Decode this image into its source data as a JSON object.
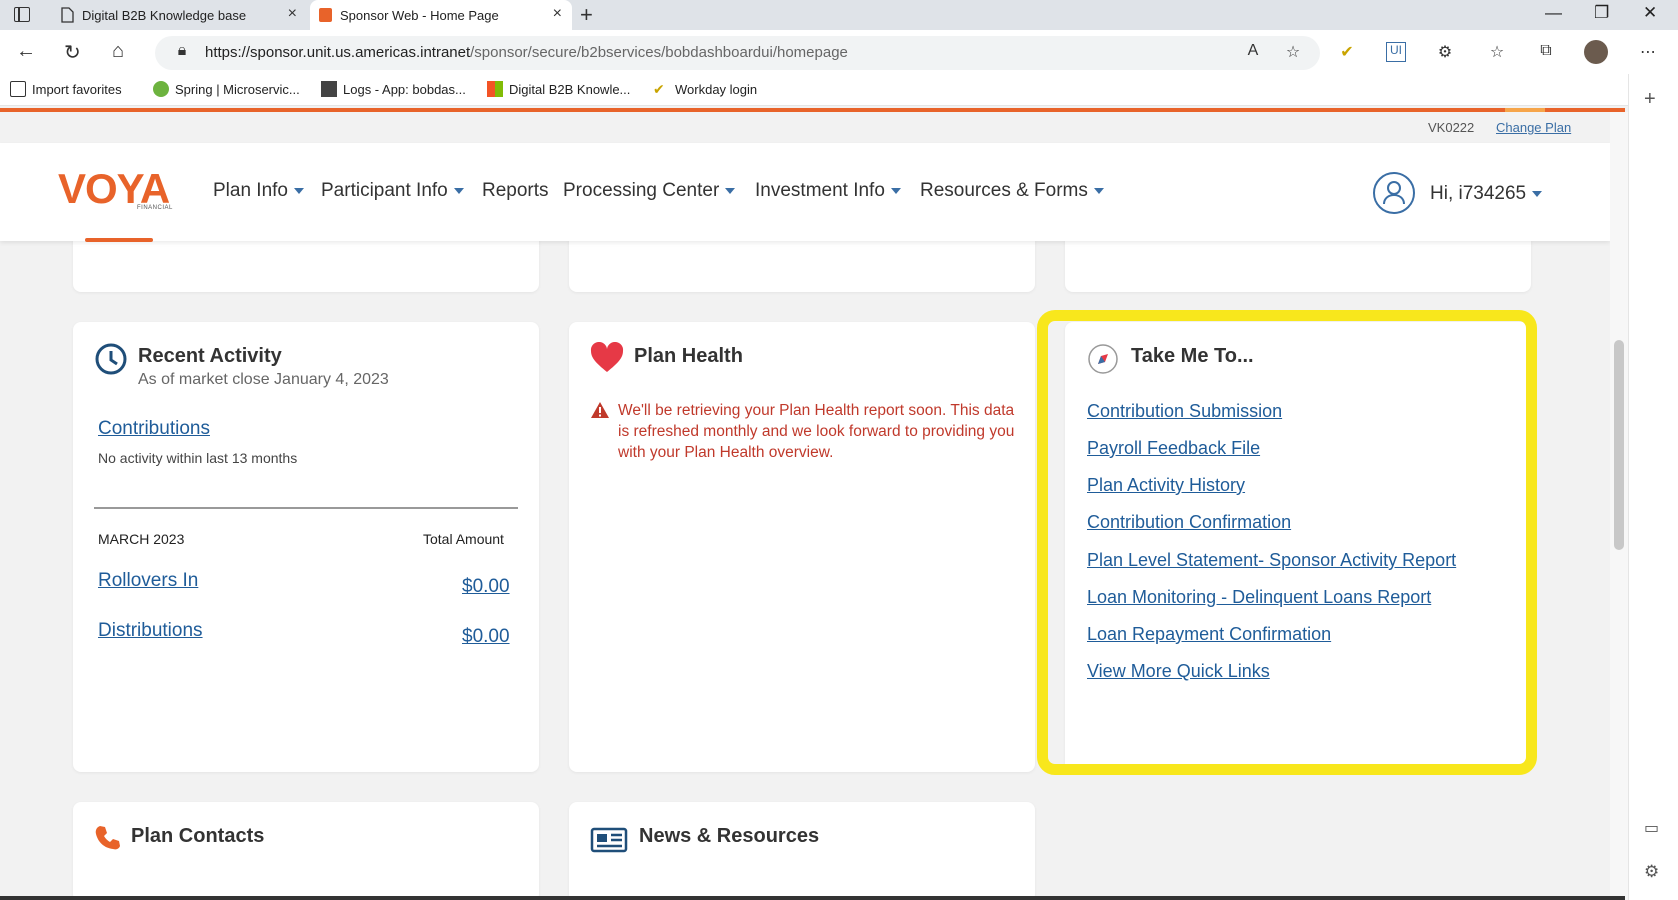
{
  "browser": {
    "tabs": [
      {
        "title": "Digital B2B Knowledge base"
      },
      {
        "title": "Sponsor Web - Home Page"
      }
    ],
    "url_host": "https://sponsor.unit.us.americas.intranet",
    "url_path": "/sponsor/secure/b2bservices/bobdashboardui/homepage",
    "favorites": [
      "Import favorites",
      "Spring | Microservic...",
      "Logs - App: bobdas...",
      "Digital B2B Knowle...",
      "Workday login"
    ]
  },
  "plan": {
    "code": "VK0222",
    "change_label": "Change Plan"
  },
  "header": {
    "logo": "VOYA",
    "logo_sub": "FINANCIAL",
    "nav": [
      "Plan Info",
      "Participant Info",
      "Reports",
      "Processing Center",
      "Investment Info",
      "Resources & Forms"
    ],
    "greeting": "Hi, i734265"
  },
  "recent_activity": {
    "title": "Recent Activity",
    "subtitle": "As of market close January 4, 2023",
    "contributions_label": "Contributions",
    "contributions_note": "No activity within last 13 months",
    "period": "MARCH 2023",
    "total_header": "Total Amount",
    "rows": [
      {
        "label": "Rollovers In",
        "amount": "$0.00"
      },
      {
        "label": "Distributions",
        "amount": "$0.00"
      }
    ]
  },
  "plan_health": {
    "title": "Plan Health",
    "message": "We'll be retrieving your Plan Health report soon. This data is refreshed monthly and we look forward to providing you with your Plan Health overview."
  },
  "take_me_to": {
    "title": "Take Me To...",
    "links": [
      "Contribution Submission",
      "Payroll Feedback File",
      "Plan Activity History",
      "Contribution Confirmation",
      "Plan Level Statement- Sponsor Activity Report",
      "Loan Monitoring - Delinquent Loans Report",
      "Loan Repayment Confirmation",
      "View More Quick Links"
    ]
  },
  "plan_contacts": {
    "title": "Plan Contacts"
  },
  "news": {
    "title": "News & Resources"
  },
  "colors": {
    "brand": "#e8632a",
    "link": "#1f5c99",
    "warning": "#c0392b",
    "highlight": "#f8e71c"
  }
}
